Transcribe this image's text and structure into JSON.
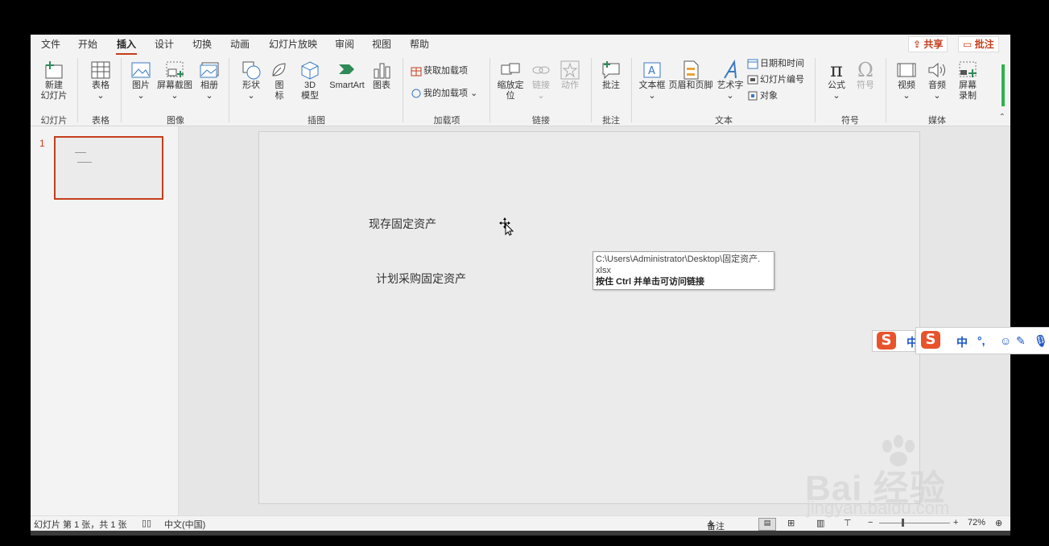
{
  "tabs": [
    "文件",
    "开始",
    "插入",
    "设计",
    "切换",
    "动画",
    "幻灯片放映",
    "审阅",
    "视图",
    "帮助"
  ],
  "active_tab": "插入",
  "share_label": "共享",
  "comment_label": "批注",
  "ribbon": {
    "new_slide": "新建\n幻灯片",
    "table": "表格",
    "picture": "图片",
    "screenshot": "屏幕截图",
    "album": "相册",
    "shapes": "形状",
    "icons": "图\n标",
    "model3d": "3D\n模型",
    "smartart": "SmartArt",
    "chart": "图表",
    "get_addins": "获取加载项",
    "my_addins": "我的加载项",
    "zoom": "缩放定\n位",
    "link": "链接",
    "action": "动作",
    "comment": "批注",
    "textbox": "文本框",
    "header_footer": "页眉和页脚",
    "wordart": "艺术字",
    "datetime": "日期和时间",
    "slide_number": "幻灯片编号",
    "object": "对象",
    "equation": "公式",
    "symbol": "符号",
    "video": "视频",
    "audio": "音频",
    "screen_record": "屏幕\n录制"
  },
  "groups": {
    "slides": "幻灯片",
    "tables": "表格",
    "images": "图像",
    "illustrations": "插图",
    "addins": "加载项",
    "links": "链接",
    "comments": "批注",
    "text": "文本",
    "symbols": "符号",
    "media": "媒体"
  },
  "thumbnail_number": "1",
  "slide": {
    "text1": "现存固定资产",
    "text2": "计划采购固定资产"
  },
  "tooltip": {
    "path_line1": "C:\\Users\\Administrator\\Desktop\\固定资产.",
    "path_line2": "xlsx",
    "hint": "按住 Ctrl 并单击可访问链接"
  },
  "status": {
    "slide_info": "幻灯片 第 1 张，共 1 张",
    "language": "中文(中国)",
    "notes": "备注",
    "zoom": "72%"
  },
  "ime": {
    "mode": "中",
    "punct": "°,",
    "logo": "S"
  },
  "watermark": {
    "brand": "Bai 经验",
    "url": "jingyan.baidu.com"
  },
  "colors": {
    "accent": "#c43e1c",
    "ime_logo": "#e8532b",
    "ime_text": "#1a56c8"
  }
}
